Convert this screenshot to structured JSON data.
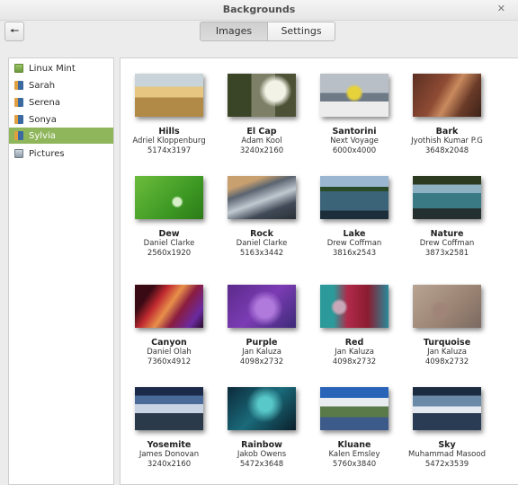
{
  "window": {
    "title": "Backgrounds",
    "close_glyph": "✕"
  },
  "toolbar": {
    "back_icon": "back-arrow-icon",
    "back_glyph": "🠔",
    "tabs": [
      {
        "label": "Images"
      },
      {
        "label": "Settings"
      }
    ],
    "active_tab": "Images"
  },
  "sidebar": {
    "items": [
      {
        "label": "Linux Mint",
        "icon": "mint-folder-icon"
      },
      {
        "label": "Sarah",
        "icon": "user-collection-icon"
      },
      {
        "label": "Serena",
        "icon": "user-collection-icon"
      },
      {
        "label": "Sonya",
        "icon": "user-collection-icon"
      },
      {
        "label": "Sylvia",
        "icon": "user-collection-icon"
      },
      {
        "label": "Pictures",
        "icon": "pictures-folder-icon"
      }
    ],
    "selected": "Sylvia",
    "colors": {
      "selected_bg": "#8fb65b"
    }
  },
  "wallpapers": [
    {
      "name": "Hills",
      "author": "Adriel Kloppenburg",
      "size": "5174x3197"
    },
    {
      "name": "El Cap",
      "author": "Adam Kool",
      "size": "3240x2160"
    },
    {
      "name": "Santorini",
      "author": "Next Voyage",
      "size": "6000x4000"
    },
    {
      "name": "Bark",
      "author": "Jyothish Kumar P.G",
      "size": "3648x2048"
    },
    {
      "name": "Dew",
      "author": "Daniel Clarke",
      "size": "2560x1920"
    },
    {
      "name": "Rock",
      "author": "Daniel Clarke",
      "size": "5163x3442"
    },
    {
      "name": "Lake",
      "author": "Drew Coffman",
      "size": "3816x2543"
    },
    {
      "name": "Nature",
      "author": "Drew Coffman",
      "size": "3873x2581"
    },
    {
      "name": "Canyon",
      "author": "Daniel Olah",
      "size": "7360x4912"
    },
    {
      "name": "Purple",
      "author": "Jan Kaluza",
      "size": "4098x2732"
    },
    {
      "name": "Red",
      "author": "Jan Kaluza",
      "size": "4098x2732"
    },
    {
      "name": "Turquoise",
      "author": "Jan Kaluza",
      "size": "4098x2732"
    },
    {
      "name": "Yosemite",
      "author": "James Donovan",
      "size": "3240x2160"
    },
    {
      "name": "Rainbow",
      "author": "Jakob Owens",
      "size": "5472x3648"
    },
    {
      "name": "Kluane",
      "author": "Kalen Emsley",
      "size": "5760x3840"
    },
    {
      "name": "Sky",
      "author": "Muhammad Masood",
      "size": "5472x3539"
    }
  ]
}
